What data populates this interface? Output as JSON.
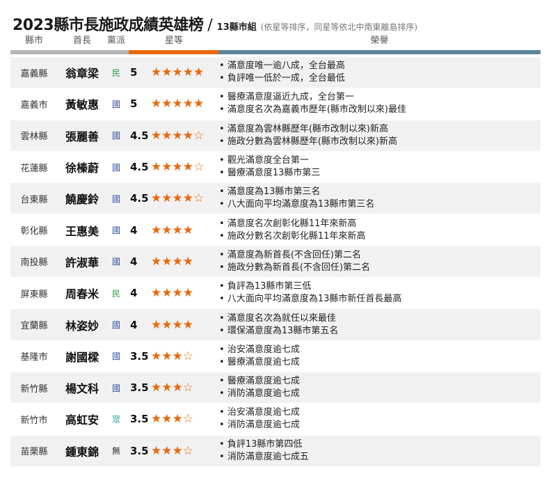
{
  "title": {
    "main": "2023縣市長施政成績英雄榜",
    "slash": "/",
    "sub": "13縣市組",
    "note": "(依星等排序，同星等依北中南東離島排序)"
  },
  "headers": {
    "county": "縣市",
    "mayor": "首長",
    "party": "黨派",
    "stars": "星等",
    "honors": "榮譽"
  },
  "colors": {
    "star": "#e8680c",
    "bar_gray": "#b4b4b4",
    "bar_orange": "#e8680c",
    "bar_blue": "#5b8497",
    "party_dpp": "#2a9a3a",
    "party_kmt": "#2c4f9e",
    "party_pfp": "#2aa6a6",
    "party_none": "#333333"
  },
  "rows": [
    {
      "county": "嘉義縣",
      "mayor": "翁章梁",
      "party": "民",
      "party_color": "#2a9a3a",
      "score": "5",
      "stars": "★★★★★",
      "honors": [
        "滿意度唯一逾八成，全台最高",
        "負評唯一低於一成，全台最低"
      ]
    },
    {
      "county": "嘉義市",
      "mayor": "黃敏惠",
      "party": "國",
      "party_color": "#2c4f9e",
      "score": "5",
      "stars": "★★★★★",
      "honors": [
        "醫療滿意度逼近九成，全台第一",
        "滿意度名次為嘉義市歷年(縣市改制以來)最佳"
      ]
    },
    {
      "county": "雲林縣",
      "mayor": "張麗善",
      "party": "國",
      "party_color": "#2c4f9e",
      "score": "4.5",
      "stars": "★★★★☆",
      "honors": [
        "滿意度為雲林縣歷年(縣市改制以來)新高",
        "施政分數為雲林縣歷年(縣市改制以來)新高"
      ]
    },
    {
      "county": "花蓮縣",
      "mayor": "徐榛蔚",
      "party": "國",
      "party_color": "#2c4f9e",
      "score": "4.5",
      "stars": "★★★★☆",
      "honors": [
        "觀光滿意度全台第一",
        "醫療滿意度13縣市第三"
      ]
    },
    {
      "county": "台東縣",
      "mayor": "饒慶鈴",
      "party": "國",
      "party_color": "#2c4f9e",
      "score": "4.5",
      "stars": "★★★★☆",
      "honors": [
        "滿意度為13縣市第三名",
        "八大面向平均滿意度為13縣市第三名"
      ]
    },
    {
      "county": "彰化縣",
      "mayor": "王惠美",
      "party": "國",
      "party_color": "#2c4f9e",
      "score": "4",
      "stars": "★★★★",
      "honors": [
        "滿意度名次創彰化縣11年來新高",
        "施政分數名次創彰化縣11年來新高"
      ]
    },
    {
      "county": "南投縣",
      "mayor": "許淑華",
      "party": "國",
      "party_color": "#2c4f9e",
      "score": "4",
      "stars": "★★★★",
      "honors": [
        "滿意度為新首長(不含回任)第二名",
        "施政分數為新首長(不含回任)第二名"
      ]
    },
    {
      "county": "屏東縣",
      "mayor": "周春米",
      "party": "民",
      "party_color": "#2a9a3a",
      "score": "4",
      "stars": "★★★★",
      "honors": [
        "負評為13縣市第三低",
        "八大面向平均滿意度為13縣市新任首長最高"
      ]
    },
    {
      "county": "宜蘭縣",
      "mayor": "林姿妙",
      "party": "國",
      "party_color": "#2c4f9e",
      "score": "4",
      "stars": "★★★★",
      "honors": [
        "滿意度名次為就任以來最佳",
        "環保滿意度為13縣市第五名"
      ]
    },
    {
      "county": "基隆市",
      "mayor": "謝國樑",
      "party": "國",
      "party_color": "#2c4f9e",
      "score": "3.5",
      "stars": "★★★☆",
      "honors": [
        "治安滿意度逾七成",
        "醫療滿意度逾七成"
      ]
    },
    {
      "county": "新竹縣",
      "mayor": "楊文科",
      "party": "國",
      "party_color": "#2c4f9e",
      "score": "3.5",
      "stars": "★★★☆",
      "honors": [
        "醫療滿意度逾七成",
        "消防滿意度逾七成"
      ]
    },
    {
      "county": "新竹市",
      "mayor": "高虹安",
      "party": "眾",
      "party_color": "#2aa6a6",
      "score": "3.5",
      "stars": "★★★☆",
      "honors": [
        "治安滿意度逾七成",
        "消防滿意度逾七成"
      ]
    },
    {
      "county": "苗栗縣",
      "mayor": "鍾東錦",
      "party": "無",
      "party_color": "#333333",
      "score": "3.5",
      "stars": "★★★☆",
      "honors": [
        "負評13縣市第四低",
        "消防滿意度逾七成五"
      ]
    }
  ]
}
